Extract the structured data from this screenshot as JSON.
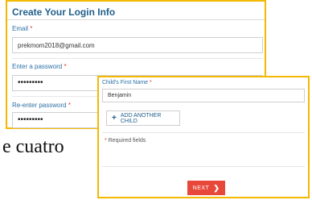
{
  "login_card": {
    "title": "Create Your Login Info",
    "email_label": "Email",
    "email_value": "prekmom2018@gmail.com",
    "password_label": "Enter a password",
    "password_value": "•••••••••",
    "reenter_label": "Re-enter password",
    "reenter_value": "•••••••••"
  },
  "required_mark": "*",
  "background_text": "e cuatro",
  "child_card": {
    "first_name_label": "Child's First Name",
    "first_name_value": "Benjamin",
    "add_child_label": "ADD ANOTHER CHILD",
    "add_child_icon": "plus-icon",
    "required_note": "Required fields",
    "next_label": "NEXT",
    "next_icon": "chevron-right-icon"
  },
  "colors": {
    "card_border": "#f5b800",
    "title": "#1f5f8b",
    "label": "#2a6fa5",
    "required": "#e03c31",
    "next_button": "#e8483a"
  }
}
